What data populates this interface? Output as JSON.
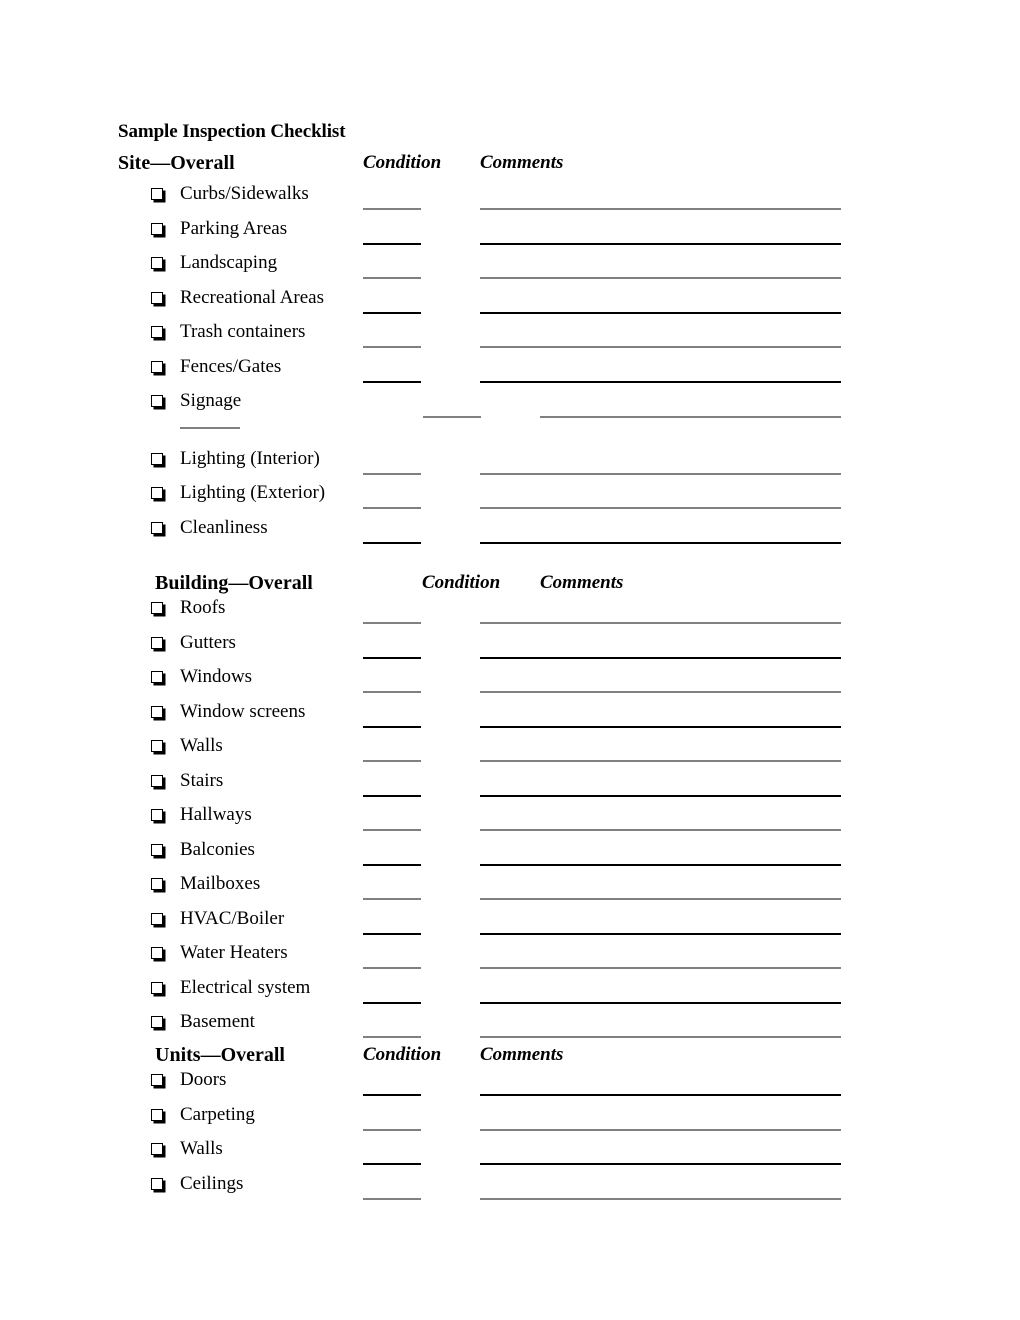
{
  "document": {
    "title": "Sample Inspection Checklist"
  },
  "columns": {
    "condition": "Condition",
    "comments": "Comments"
  },
  "sections": [
    {
      "id": "site",
      "heading": "Site—Overall",
      "condition_label": "Condition",
      "comments_label": "Comments",
      "items": [
        {
          "label": "Curbs/Sidewalks",
          "checkbox": "checkbox-icon",
          "condition_line": "",
          "comments_line": ""
        },
        {
          "label": "Parking Areas",
          "checkbox": "checkbox-icon",
          "condition_line": "",
          "comments_line": ""
        },
        {
          "label": "Landscaping",
          "checkbox": "checkbox-icon",
          "condition_line": "",
          "comments_line": ""
        },
        {
          "label": "Recreational Areas",
          "checkbox": "checkbox-icon",
          "condition_line": "",
          "comments_line": ""
        },
        {
          "label": "Trash containers",
          "checkbox": "checkbox-icon",
          "condition_line": "",
          "comments_line": ""
        },
        {
          "label": "Fences/Gates",
          "checkbox": "checkbox-icon",
          "condition_line": "",
          "comments_line": ""
        },
        {
          "label": "Signage",
          "checkbox": "checkbox-icon",
          "condition_line": "",
          "comments_line": ""
        },
        {
          "label": "Lighting (Interior)",
          "checkbox": "checkbox-icon",
          "condition_line": "",
          "comments_line": ""
        },
        {
          "label": "Lighting (Exterior)",
          "checkbox": "checkbox-icon",
          "condition_line": "",
          "comments_line": ""
        },
        {
          "label": "Cleanliness",
          "checkbox": "checkbox-icon",
          "condition_line": "",
          "comments_line": ""
        }
      ]
    },
    {
      "id": "building",
      "heading": "Building—Overall",
      "condition_label": "Condition",
      "comments_label": "Comments",
      "items": [
        {
          "label": "Roofs",
          "checkbox": "checkbox-icon",
          "condition_line": "",
          "comments_line": ""
        },
        {
          "label": "Gutters",
          "checkbox": "checkbox-icon",
          "condition_line": "",
          "comments_line": ""
        },
        {
          "label": "Windows",
          "checkbox": "checkbox-icon",
          "condition_line": "",
          "comments_line": ""
        },
        {
          "label": "Window screens",
          "checkbox": "checkbox-icon",
          "condition_line": "",
          "comments_line": ""
        },
        {
          "label": "Walls",
          "checkbox": "checkbox-icon",
          "condition_line": "",
          "comments_line": ""
        },
        {
          "label": "Stairs",
          "checkbox": "checkbox-icon",
          "condition_line": "",
          "comments_line": ""
        },
        {
          "label": "Hallways",
          "checkbox": "checkbox-icon",
          "condition_line": "",
          "comments_line": ""
        },
        {
          "label": "Balconies",
          "checkbox": "checkbox-icon",
          "condition_line": "",
          "comments_line": ""
        },
        {
          "label": "Mailboxes",
          "checkbox": "checkbox-icon",
          "condition_line": "",
          "comments_line": ""
        },
        {
          "label": "HVAC/Boiler",
          "checkbox": "checkbox-icon",
          "condition_line": "",
          "comments_line": ""
        },
        {
          "label": "Water Heaters",
          "checkbox": "checkbox-icon",
          "condition_line": "",
          "comments_line": ""
        },
        {
          "label": "Electrical system",
          "checkbox": "checkbox-icon",
          "condition_line": "",
          "comments_line": ""
        },
        {
          "label": "Basement",
          "checkbox": "checkbox-icon",
          "condition_line": "",
          "comments_line": ""
        }
      ]
    },
    {
      "id": "units",
      "heading": "Units—Overall",
      "condition_label": "Condition",
      "comments_label": "Comments",
      "items": [
        {
          "label": "Doors",
          "checkbox": "checkbox-icon",
          "condition_line": "",
          "comments_line": ""
        },
        {
          "label": "Carpeting",
          "checkbox": "checkbox-icon",
          "condition_line": "",
          "comments_line": ""
        },
        {
          "label": "Walls",
          "checkbox": "checkbox-icon",
          "condition_line": "",
          "comments_line": ""
        },
        {
          "label": "Ceilings",
          "checkbox": "checkbox-icon",
          "condition_line": "",
          "comments_line": ""
        }
      ]
    }
  ]
}
